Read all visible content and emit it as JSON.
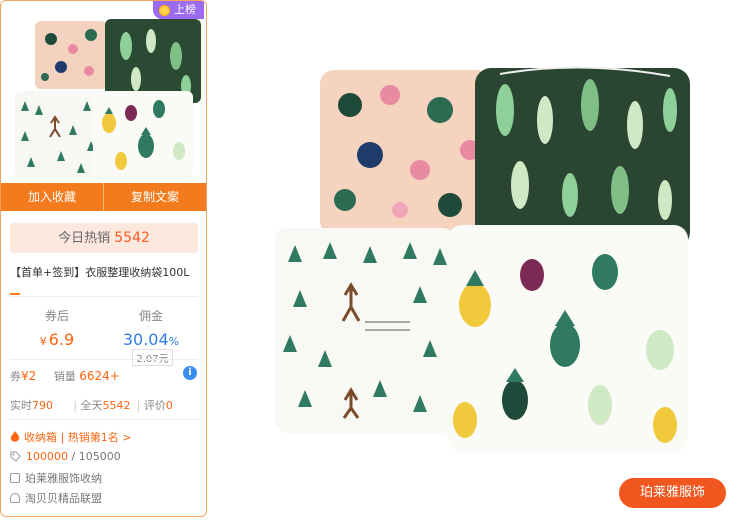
{
  "card": {
    "badge": "上榜",
    "actions": {
      "favorite": "加入收藏",
      "copy": "复制文案"
    },
    "hot": {
      "label": "今日热销",
      "value": "5542"
    },
    "title": "【首单+签到】衣服整理收纳袋100L",
    "prices": {
      "after_coupon_label": "券后",
      "currency": "¥",
      "after_coupon_value": "6.9",
      "commission_label": "佣金",
      "commission_rate": "30.04",
      "percent": "%",
      "commission_amount": "2.07元"
    },
    "stats1": {
      "coupon_label": "券",
      "coupon_value": "¥2",
      "sales_label": "销量",
      "sales_value": "6624+"
    },
    "stats2": {
      "realtime_label": "实时",
      "realtime_value": "790",
      "allday_label": "全天",
      "allday_value": "5542",
      "rating_label": "评价",
      "rating_value": "0"
    },
    "rank": "收纳箱 | 热销第1名 >",
    "stock": {
      "used": "100000",
      "total": " / 105000"
    },
    "shop": "珀莱雅服饰收纳",
    "alliance": "淘贝贝精品联盟"
  },
  "shop_button": "珀莱雅服饰",
  "colors": {
    "accent": "#f37b1d",
    "hot_bg": "#fde8de",
    "price": "#ff6410",
    "commission": "#2f7fe8",
    "badge": "#9b6cf0",
    "shop_button": "#f0561e"
  }
}
